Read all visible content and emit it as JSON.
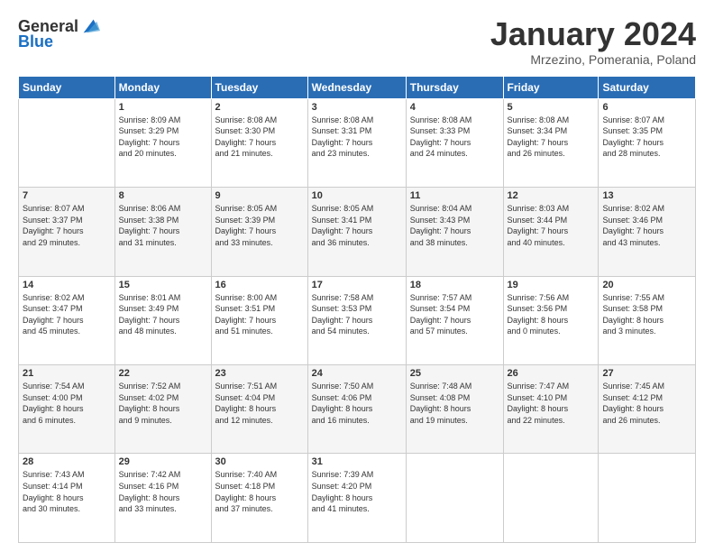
{
  "header": {
    "logo_general": "General",
    "logo_blue": "Blue",
    "month_title": "January 2024",
    "subtitle": "Mrzezino, Pomerania, Poland"
  },
  "weekdays": [
    "Sunday",
    "Monday",
    "Tuesday",
    "Wednesday",
    "Thursday",
    "Friday",
    "Saturday"
  ],
  "weeks": [
    [
      {
        "day": "",
        "info": ""
      },
      {
        "day": "1",
        "info": "Sunrise: 8:09 AM\nSunset: 3:29 PM\nDaylight: 7 hours\nand 20 minutes."
      },
      {
        "day": "2",
        "info": "Sunrise: 8:08 AM\nSunset: 3:30 PM\nDaylight: 7 hours\nand 21 minutes."
      },
      {
        "day": "3",
        "info": "Sunrise: 8:08 AM\nSunset: 3:31 PM\nDaylight: 7 hours\nand 23 minutes."
      },
      {
        "day": "4",
        "info": "Sunrise: 8:08 AM\nSunset: 3:33 PM\nDaylight: 7 hours\nand 24 minutes."
      },
      {
        "day": "5",
        "info": "Sunrise: 8:08 AM\nSunset: 3:34 PM\nDaylight: 7 hours\nand 26 minutes."
      },
      {
        "day": "6",
        "info": "Sunrise: 8:07 AM\nSunset: 3:35 PM\nDaylight: 7 hours\nand 28 minutes."
      }
    ],
    [
      {
        "day": "7",
        "info": "Sunrise: 8:07 AM\nSunset: 3:37 PM\nDaylight: 7 hours\nand 29 minutes."
      },
      {
        "day": "8",
        "info": "Sunrise: 8:06 AM\nSunset: 3:38 PM\nDaylight: 7 hours\nand 31 minutes."
      },
      {
        "day": "9",
        "info": "Sunrise: 8:05 AM\nSunset: 3:39 PM\nDaylight: 7 hours\nand 33 minutes."
      },
      {
        "day": "10",
        "info": "Sunrise: 8:05 AM\nSunset: 3:41 PM\nDaylight: 7 hours\nand 36 minutes."
      },
      {
        "day": "11",
        "info": "Sunrise: 8:04 AM\nSunset: 3:43 PM\nDaylight: 7 hours\nand 38 minutes."
      },
      {
        "day": "12",
        "info": "Sunrise: 8:03 AM\nSunset: 3:44 PM\nDaylight: 7 hours\nand 40 minutes."
      },
      {
        "day": "13",
        "info": "Sunrise: 8:02 AM\nSunset: 3:46 PM\nDaylight: 7 hours\nand 43 minutes."
      }
    ],
    [
      {
        "day": "14",
        "info": "Sunrise: 8:02 AM\nSunset: 3:47 PM\nDaylight: 7 hours\nand 45 minutes."
      },
      {
        "day": "15",
        "info": "Sunrise: 8:01 AM\nSunset: 3:49 PM\nDaylight: 7 hours\nand 48 minutes."
      },
      {
        "day": "16",
        "info": "Sunrise: 8:00 AM\nSunset: 3:51 PM\nDaylight: 7 hours\nand 51 minutes."
      },
      {
        "day": "17",
        "info": "Sunrise: 7:58 AM\nSunset: 3:53 PM\nDaylight: 7 hours\nand 54 minutes."
      },
      {
        "day": "18",
        "info": "Sunrise: 7:57 AM\nSunset: 3:54 PM\nDaylight: 7 hours\nand 57 minutes."
      },
      {
        "day": "19",
        "info": "Sunrise: 7:56 AM\nSunset: 3:56 PM\nDaylight: 8 hours\nand 0 minutes."
      },
      {
        "day": "20",
        "info": "Sunrise: 7:55 AM\nSunset: 3:58 PM\nDaylight: 8 hours\nand 3 minutes."
      }
    ],
    [
      {
        "day": "21",
        "info": "Sunrise: 7:54 AM\nSunset: 4:00 PM\nDaylight: 8 hours\nand 6 minutes."
      },
      {
        "day": "22",
        "info": "Sunrise: 7:52 AM\nSunset: 4:02 PM\nDaylight: 8 hours\nand 9 minutes."
      },
      {
        "day": "23",
        "info": "Sunrise: 7:51 AM\nSunset: 4:04 PM\nDaylight: 8 hours\nand 12 minutes."
      },
      {
        "day": "24",
        "info": "Sunrise: 7:50 AM\nSunset: 4:06 PM\nDaylight: 8 hours\nand 16 minutes."
      },
      {
        "day": "25",
        "info": "Sunrise: 7:48 AM\nSunset: 4:08 PM\nDaylight: 8 hours\nand 19 minutes."
      },
      {
        "day": "26",
        "info": "Sunrise: 7:47 AM\nSunset: 4:10 PM\nDaylight: 8 hours\nand 22 minutes."
      },
      {
        "day": "27",
        "info": "Sunrise: 7:45 AM\nSunset: 4:12 PM\nDaylight: 8 hours\nand 26 minutes."
      }
    ],
    [
      {
        "day": "28",
        "info": "Sunrise: 7:43 AM\nSunset: 4:14 PM\nDaylight: 8 hours\nand 30 minutes."
      },
      {
        "day": "29",
        "info": "Sunrise: 7:42 AM\nSunset: 4:16 PM\nDaylight: 8 hours\nand 33 minutes."
      },
      {
        "day": "30",
        "info": "Sunrise: 7:40 AM\nSunset: 4:18 PM\nDaylight: 8 hours\nand 37 minutes."
      },
      {
        "day": "31",
        "info": "Sunrise: 7:39 AM\nSunset: 4:20 PM\nDaylight: 8 hours\nand 41 minutes."
      },
      {
        "day": "",
        "info": ""
      },
      {
        "day": "",
        "info": ""
      },
      {
        "day": "",
        "info": ""
      }
    ]
  ]
}
